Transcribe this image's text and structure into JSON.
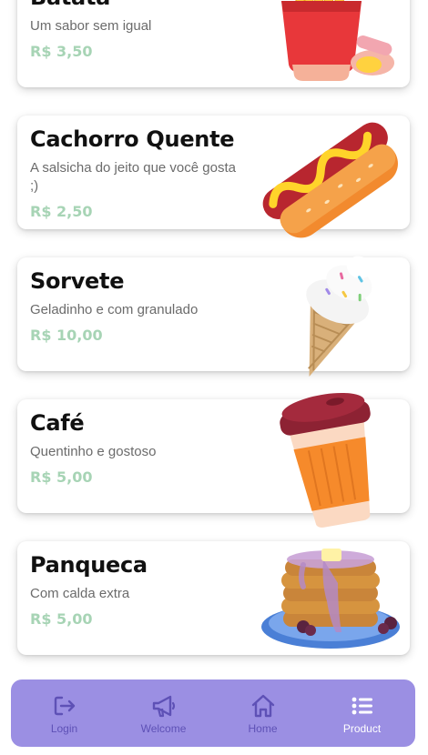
{
  "products": [
    {
      "title": "Batata",
      "description": "Um sabor sem igual",
      "price": "R$ 3,50",
      "image": "fries-icon"
    },
    {
      "title": "Cachorro Quente",
      "description": "A salsicha do jeito que você gosta ;)",
      "price": "R$ 2,50",
      "image": "hotdog-icon"
    },
    {
      "title": "Sorvete",
      "description": "Geladinho e com granulado",
      "price": "R$ 10,00",
      "image": "ice-cream-icon"
    },
    {
      "title": "Café",
      "description": "Quentinho e gostoso",
      "price": "R$ 5,00",
      "image": "coffee-cup-icon"
    },
    {
      "title": "Panqueca",
      "description": "Com calda extra",
      "price": "R$ 5,00",
      "image": "pancakes-icon"
    }
  ],
  "nav": {
    "items": [
      {
        "label": "Login",
        "icon": "login-icon"
      },
      {
        "label": "Welcome",
        "icon": "megaphone-icon"
      },
      {
        "label": "Home",
        "icon": "home-icon"
      },
      {
        "label": "Product",
        "icon": "list-icon"
      }
    ],
    "active": "Product"
  },
  "colors": {
    "price": "#a7d4b5",
    "nav_background": "#9b8fe3",
    "nav_inactive": "#5e51b6",
    "nav_active": "#ffffff"
  }
}
